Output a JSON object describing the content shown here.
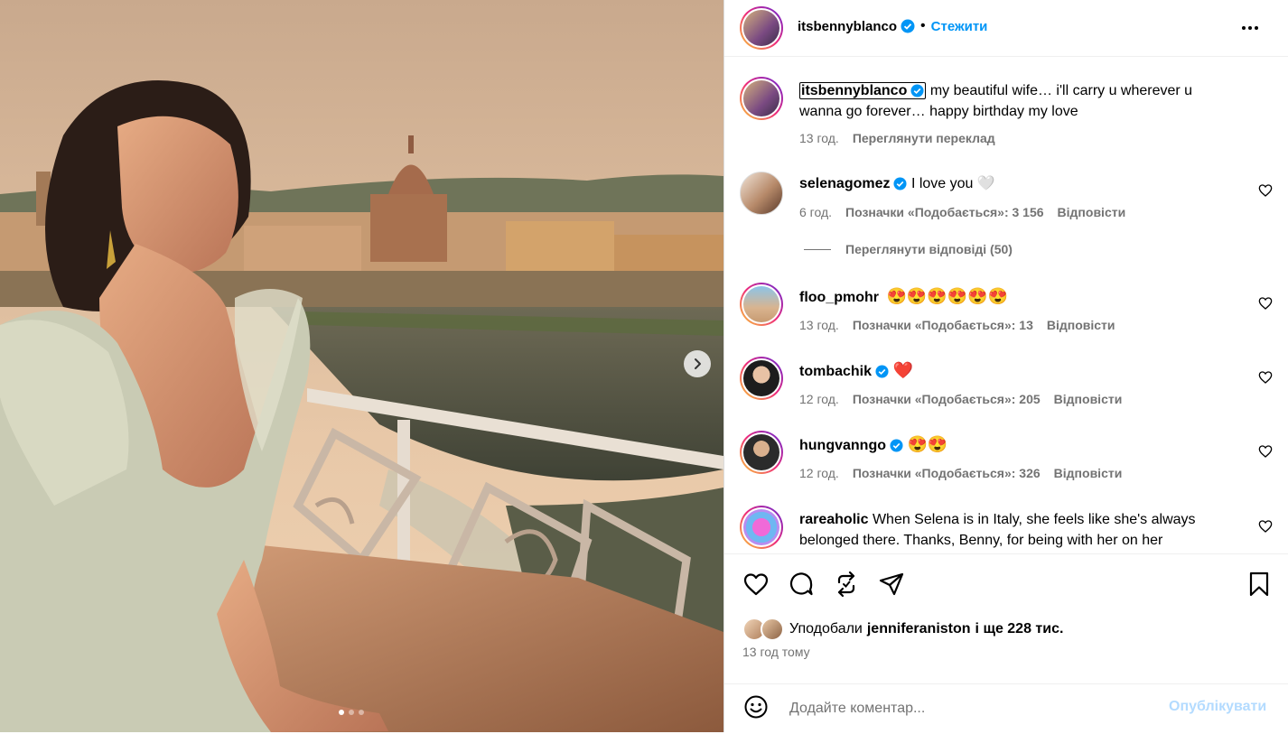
{
  "post": {
    "author": "itsbennyblanco",
    "follow_label": "Стежити",
    "follow_separator": "•",
    "more_icon": "ellipsis-icon"
  },
  "caption": {
    "username": "itsbennyblanco",
    "text": "my beautiful wife… i'll carry u wherever u wanna go forever… happy birthday my love",
    "time": "13 год.",
    "translate_label": "Переглянути переклад"
  },
  "comments": [
    {
      "username": "selenagomez",
      "verified": true,
      "text": "I love you 🤍",
      "time": "6 год.",
      "likes": "Позначки «Подобається»: 3 156",
      "reply": "Відповісти"
    },
    {
      "username": "floo_pmohr",
      "verified": false,
      "text": "😍😍😍😍😍😍",
      "time": "13 год.",
      "likes": "Позначки «Подобається»: 13",
      "reply": "Відповісти"
    },
    {
      "username": "tombachik",
      "verified": true,
      "text": "❤️",
      "time": "12 год.",
      "likes": "Позначки «Подобається»: 205",
      "reply": "Відповісти"
    },
    {
      "username": "hungvanngo",
      "verified": true,
      "text": "😍😍",
      "time": "12 год.",
      "likes": "Позначки «Подобається»: 326",
      "reply": "Відповісти"
    },
    {
      "username": "rareaholic",
      "verified": false,
      "text": "When Selena is in Italy, she feels like she's always belonged there. Thanks, Benny, for being with her on her",
      "time": "",
      "likes": "",
      "reply": ""
    }
  ],
  "view_replies": "Переглянути відповіді (50)",
  "likes_line": {
    "prefix": "Уподобали",
    "user": "jenniferaniston",
    "suffix": "і ще 228 тис."
  },
  "post_time": "13 год тому",
  "add_comment": {
    "placeholder": "Додайте коментар...",
    "publish_label": "Опублікувати"
  },
  "carousel": {
    "total_slides": 3,
    "current_slide": 1
  },
  "colors": {
    "accent": "#0095f6",
    "publish_disabled": "#b3dbff",
    "muted_text": "#737373",
    "heart_red": "#ed1c24"
  }
}
